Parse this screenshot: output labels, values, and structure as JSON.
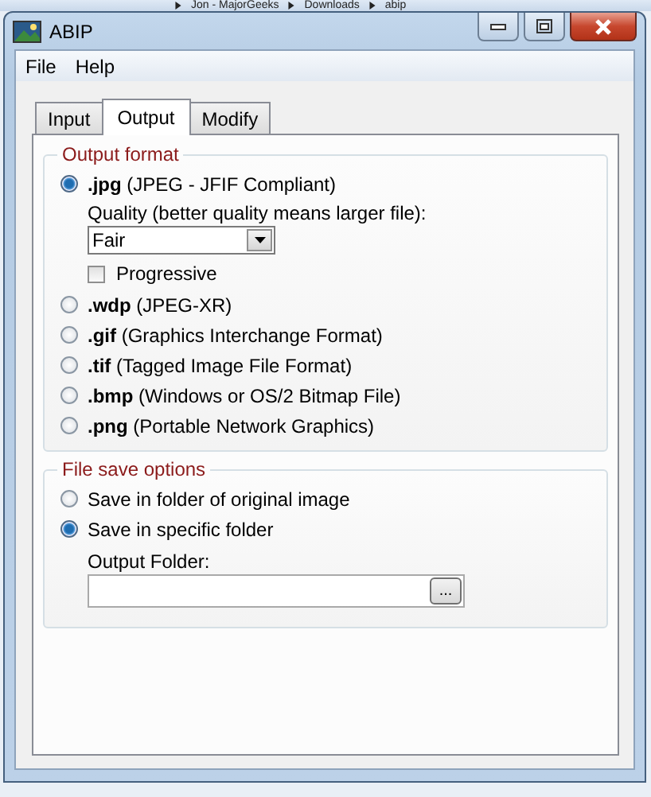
{
  "background_window": {
    "breadcrumb": [
      "Jon - MajorGeeks",
      "Downloads",
      "abip"
    ]
  },
  "window": {
    "title": "ABIP",
    "controls": [
      {
        "kind": "minimize"
      },
      {
        "kind": "maximize"
      },
      {
        "kind": "close"
      }
    ]
  },
  "menu": [
    "File",
    "Help"
  ],
  "tabs": [
    {
      "label": "Input",
      "selected": false
    },
    {
      "label": "Output",
      "selected": true
    },
    {
      "label": "Modify",
      "selected": false
    }
  ],
  "output_format": {
    "title": "Output format",
    "options": [
      {
        "ext": ".jpg",
        "desc": "(JPEG - JFIF Compliant)",
        "selected": true
      },
      {
        "ext": ".wdp",
        "desc": "(JPEG-XR)",
        "selected": false
      },
      {
        "ext": ".gif",
        "desc": "(Graphics Interchange Format)",
        "selected": false
      },
      {
        "ext": ".tif",
        "desc": "(Tagged Image File Format)",
        "selected": false
      },
      {
        "ext": ".bmp",
        "desc": "(Windows or OS/2 Bitmap File)",
        "selected": false
      },
      {
        "ext": ".png",
        "desc": "(Portable Network Graphics)",
        "selected": false
      }
    ],
    "quality": {
      "label": "Quality (better quality means larger file):",
      "value": "Fair"
    },
    "progressive": {
      "label": "Progressive",
      "checked": false
    }
  },
  "file_save_options": {
    "title": "File save options",
    "options": [
      {
        "label": "Save in folder of original image",
        "selected": false
      },
      {
        "label": "Save in specific folder",
        "selected": true
      }
    ],
    "output_folder": {
      "label": "Output Folder:",
      "browse_button": "..."
    }
  }
}
